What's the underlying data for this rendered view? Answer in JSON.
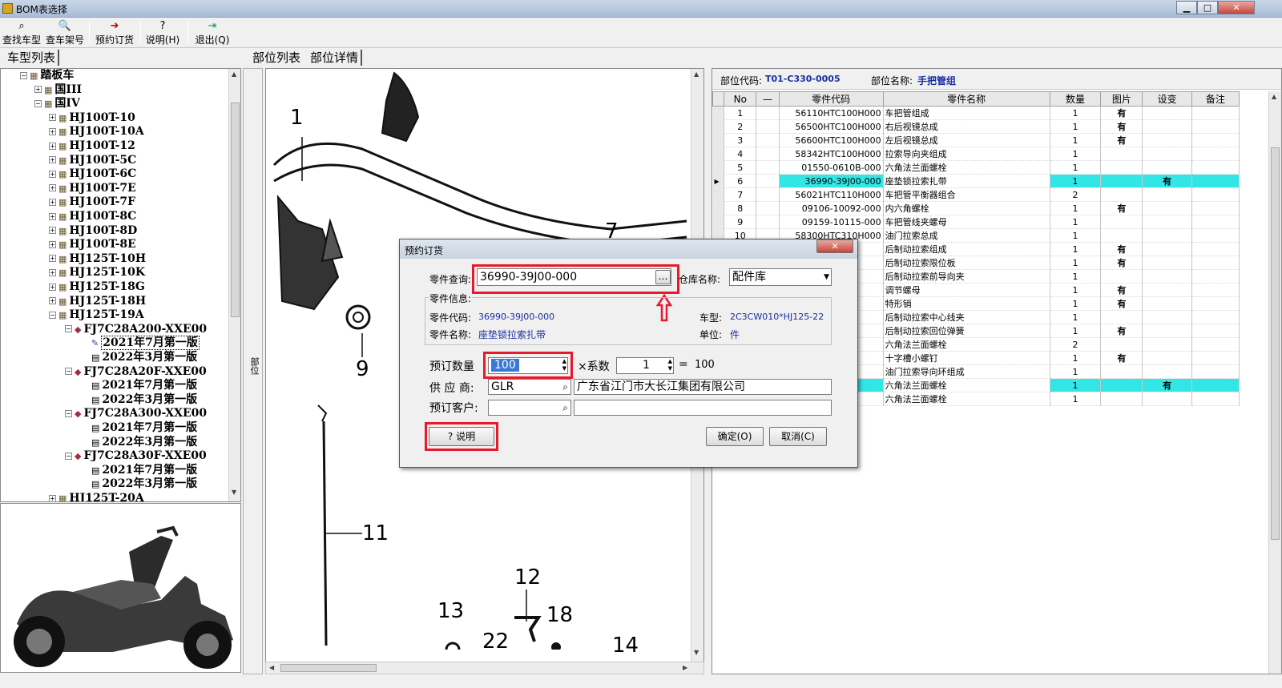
{
  "window": {
    "title": "BOM表选择",
    "min": "▁",
    "max": "□",
    "close": "✕"
  },
  "toolbar": [
    {
      "label": "查找车型",
      "icon": "binoculars-icon",
      "glyph": "⌕"
    },
    {
      "label": "查车架号",
      "icon": "search-doc-icon",
      "glyph": "🔍"
    },
    {
      "label": "预约订货",
      "icon": "order-icon",
      "glyph": "➜"
    },
    {
      "label": "说明(H)",
      "icon": "help-icon",
      "glyph": "?"
    },
    {
      "label": "退出(Q)",
      "icon": "exit-icon",
      "glyph": "⇥"
    }
  ],
  "left_tab": "车型列表",
  "center_tabs": [
    "部位列表",
    "部位详情"
  ],
  "tree": [
    {
      "text": "踏板车",
      "level": 0,
      "pm": "−",
      "icon": "folder"
    },
    {
      "text": "国III",
      "level": 1,
      "pm": "+",
      "icon": "folder"
    },
    {
      "text": "国IV",
      "level": 1,
      "pm": "−",
      "icon": "folder"
    },
    {
      "text": "HJ100T-10",
      "level": 2,
      "pm": "+",
      "icon": "folder"
    },
    {
      "text": "HJ100T-10A",
      "level": 2,
      "pm": "+",
      "icon": "folder"
    },
    {
      "text": "HJ100T-12",
      "level": 2,
      "pm": "+",
      "icon": "folder"
    },
    {
      "text": "HJ100T-5C",
      "level": 2,
      "pm": "+",
      "icon": "folder"
    },
    {
      "text": "HJ100T-6C",
      "level": 2,
      "pm": "+",
      "icon": "folder"
    },
    {
      "text": "HJ100T-7E",
      "level": 2,
      "pm": "+",
      "icon": "folder"
    },
    {
      "text": "HJ100T-7F",
      "level": 2,
      "pm": "+",
      "icon": "folder"
    },
    {
      "text": "HJ100T-8C",
      "level": 2,
      "pm": "+",
      "icon": "folder"
    },
    {
      "text": "HJ100T-8D",
      "level": 2,
      "pm": "+",
      "icon": "folder"
    },
    {
      "text": "HJ100T-8E",
      "level": 2,
      "pm": "+",
      "icon": "folder"
    },
    {
      "text": "HJ125T-10H",
      "level": 2,
      "pm": "+",
      "icon": "folder"
    },
    {
      "text": "HJ125T-10K",
      "level": 2,
      "pm": "+",
      "icon": "folder"
    },
    {
      "text": "HJ125T-18G",
      "level": 2,
      "pm": "+",
      "icon": "folder"
    },
    {
      "text": "HJ125T-18H",
      "level": 2,
      "pm": "+",
      "icon": "folder"
    },
    {
      "text": "HJ125T-19A",
      "level": 2,
      "pm": "−",
      "icon": "folder"
    },
    {
      "text": "FJ7C28A200-XXE00",
      "level": 3,
      "pm": "−",
      "icon": "book"
    },
    {
      "text": "2021年7月第一版",
      "level": 4,
      "pm": "",
      "icon": "pen",
      "selected": true
    },
    {
      "text": "2022年3月第一版",
      "level": 4,
      "pm": "",
      "icon": "doc"
    },
    {
      "text": "FJ7C28A20F-XXE00",
      "level": 3,
      "pm": "−",
      "icon": "book"
    },
    {
      "text": "2021年7月第一版",
      "level": 4,
      "pm": "",
      "icon": "doc"
    },
    {
      "text": "2022年3月第一版",
      "level": 4,
      "pm": "",
      "icon": "doc"
    },
    {
      "text": "FJ7C28A300-XXE00",
      "level": 3,
      "pm": "−",
      "icon": "book"
    },
    {
      "text": "2021年7月第一版",
      "level": 4,
      "pm": "",
      "icon": "doc"
    },
    {
      "text": "2022年3月第一版",
      "level": 4,
      "pm": "",
      "icon": "doc"
    },
    {
      "text": "FJ7C28A30F-XXE00",
      "level": 3,
      "pm": "−",
      "icon": "book"
    },
    {
      "text": "2021年7月第一版",
      "level": 4,
      "pm": "",
      "icon": "doc"
    },
    {
      "text": "2022年3月第一版",
      "level": 4,
      "pm": "",
      "icon": "doc"
    },
    {
      "text": "HJ125T-20A",
      "level": 2,
      "pm": "+",
      "icon": "folder"
    }
  ],
  "side_label": "部位",
  "drawing_callouts": [
    "1",
    "7",
    "9",
    "11",
    "12",
    "13",
    "18",
    "22",
    "14"
  ],
  "part_header": {
    "code_label": "部位代码:",
    "code": "T01-C330-0005",
    "name_label": "部位名称:",
    "name": "手把管组"
  },
  "grid": {
    "columns": [
      "No",
      "—",
      "零件代码",
      "零件名称",
      "数量",
      "图片",
      "设变",
      "备注"
    ],
    "rows": [
      {
        "no": "1",
        "code": "56110HTC100H000",
        "name": "车把管组成",
        "qty": "1",
        "pic": "有",
        "chg": "",
        "hl": false
      },
      {
        "no": "2",
        "code": "56500HTC100H000",
        "name": "右后视镜总成",
        "qty": "1",
        "pic": "有",
        "chg": "",
        "hl": false
      },
      {
        "no": "3",
        "code": "56600HTC100H000",
        "name": "左后视镜总成",
        "qty": "1",
        "pic": "有",
        "chg": "",
        "hl": false
      },
      {
        "no": "4",
        "code": "58342HTC100H000",
        "name": "拉索导向夹组成",
        "qty": "1",
        "pic": "",
        "chg": "",
        "hl": false
      },
      {
        "no": "5",
        "code": "01550-0610B-000",
        "name": "六角法兰面螺栓",
        "qty": "1",
        "pic": "",
        "chg": "",
        "hl": false
      },
      {
        "no": "6",
        "code": "36990-39J00-000",
        "name": "座垫锁拉索扎带",
        "qty": "1",
        "pic": "",
        "chg": "有",
        "hl": true,
        "cur": true
      },
      {
        "no": "7",
        "code": "56021HTC110H000",
        "name": "车把管平衡器组合",
        "qty": "2",
        "pic": "",
        "chg": "",
        "hl": false
      },
      {
        "no": "8",
        "code": "09106-10092-000",
        "name": "内六角螺栓",
        "qty": "1",
        "pic": "有",
        "chg": "",
        "hl": false
      },
      {
        "no": "9",
        "code": "09159-10115-000",
        "name": "车把管线夹螺母",
        "qty": "1",
        "pic": "",
        "chg": "",
        "hl": false
      },
      {
        "no": "10",
        "code": "58300HTC310H000",
        "name": "油门拉索总成",
        "qty": "1",
        "pic": "",
        "chg": "",
        "hl": false
      },
      {
        "no": "",
        "code": "",
        "name": "后制动拉索组成",
        "qty": "1",
        "pic": "有",
        "chg": "",
        "hl": false
      },
      {
        "no": "",
        "code": "",
        "name": "后制动拉索限位板",
        "qty": "1",
        "pic": "有",
        "chg": "",
        "hl": false
      },
      {
        "no": "",
        "code": "",
        "name": "后制动拉索前导向夹",
        "qty": "1",
        "pic": "",
        "chg": "",
        "hl": false
      },
      {
        "no": "",
        "code": "",
        "name": "调节螺母",
        "qty": "1",
        "pic": "有",
        "chg": "",
        "hl": false
      },
      {
        "no": "",
        "code": "",
        "name": "特形销",
        "qty": "1",
        "pic": "有",
        "chg": "",
        "hl": false
      },
      {
        "no": "",
        "code": "",
        "name": "后制动拉索中心线夹",
        "qty": "1",
        "pic": "",
        "chg": "",
        "hl": false
      },
      {
        "no": "",
        "code": "",
        "name": "后制动拉索回位弹簧",
        "qty": "1",
        "pic": "有",
        "chg": "",
        "hl": false
      },
      {
        "no": "",
        "code": "",
        "name": "六角法兰面螺栓",
        "qty": "2",
        "pic": "",
        "chg": "",
        "hl": false
      },
      {
        "no": "",
        "code": "",
        "name": "十字槽小螺钉",
        "qty": "1",
        "pic": "有",
        "chg": "",
        "hl": false
      },
      {
        "no": "",
        "code": "",
        "name": "油门拉索导向环组成",
        "qty": "1",
        "pic": "",
        "chg": "",
        "hl": false
      },
      {
        "no": "",
        "code": "",
        "name": "六角法兰面螺栓",
        "qty": "1",
        "pic": "",
        "chg": "有",
        "hl": true
      },
      {
        "no": "",
        "code": "",
        "name": "六角法兰面螺栓",
        "qty": "1",
        "pic": "",
        "chg": "",
        "hl": false
      }
    ]
  },
  "dialog": {
    "title": "预约订货",
    "close": "✕",
    "query_label": "零件查询:",
    "query_value": "36990-39J00-000",
    "ellipsis": "…",
    "warehouse_label": "仓库名称:",
    "warehouse_value": "配件库",
    "info_group": "零件信息:",
    "code_label": "零件代码:",
    "code_value": "36990-39J00-000",
    "model_label": "车型:",
    "model_value": "2C3CW010*HJ125-22",
    "name_label": "零件名称:",
    "name_value": "座垫锁拉索扎带",
    "unit_label": "单位:",
    "unit_value": "件",
    "qty_label": "预订数量",
    "qty_value": "100",
    "factor_label": "×系数",
    "factor_value": "1",
    "equals": "=",
    "total": "100",
    "supplier_label": "供 应 商:",
    "supplier_code": "GLR",
    "supplier_name": "广东省江门市大长江集团有限公司",
    "customer_label": "预订客户:",
    "customer_code": "",
    "customer_name": "",
    "help_button": "说明",
    "ok_button": "确定(O)",
    "cancel_button": "取消(C)"
  },
  "colors": {
    "highlight": "#33e6e6",
    "annotation": "#e8192c",
    "info_blue": "#1a2fa0"
  }
}
